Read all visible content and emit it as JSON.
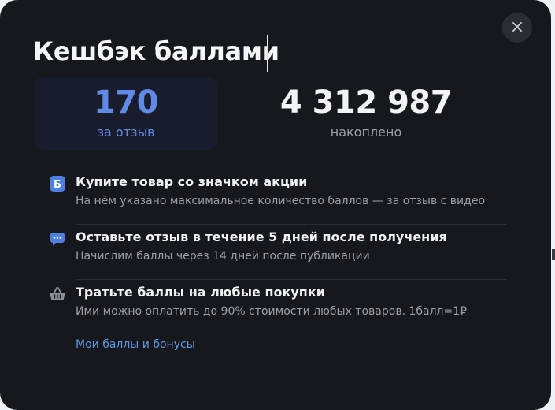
{
  "modal": {
    "title": "Кешбэк баллами",
    "close_label": "×"
  },
  "stats": {
    "per_review": {
      "value": "170",
      "caption": "за отзыв"
    },
    "accumulated": {
      "value": "4 312 987",
      "caption": "накоплено"
    }
  },
  "steps": [
    {
      "icon": "letter-b-badge-icon",
      "icon_text": "Б",
      "title": "Купите товар со значком акции",
      "description": "На нём указано максимальное количество баллов — за отзыв с видео"
    },
    {
      "icon": "chat-bubble-icon",
      "title": "Оставьте отзыв в течение 5 дней после получения",
      "description": "Начислим баллы через 14 дней после публикации"
    },
    {
      "icon": "shopping-basket-icon",
      "title": "Тратьте баллы на любые покупки",
      "description": "Ими можно оплатить до 90% стоимости любых товаров. 1балл=1₽"
    }
  ],
  "link": {
    "label": "Мои баллы и бонусы"
  },
  "colors": {
    "background": "#16181d",
    "accent": "#5f8ae6",
    "link": "#5d9ae0"
  }
}
